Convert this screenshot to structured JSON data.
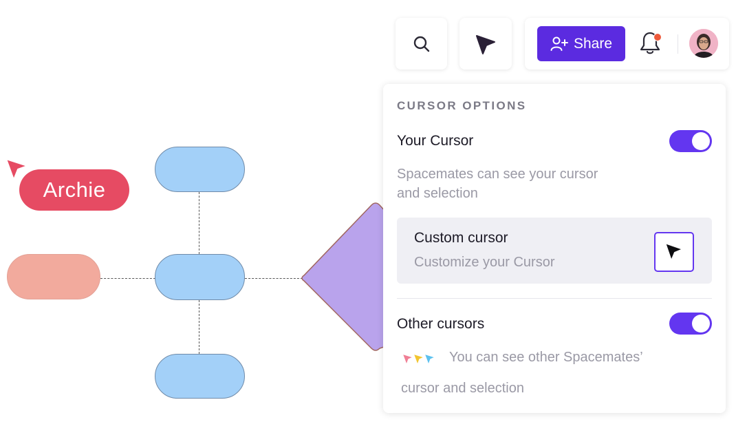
{
  "canvas": {
    "collaborator_name": "Archie",
    "colors": {
      "node_fill": "#a3d0f8",
      "node_border": "#6f8aa8",
      "salmon_node": "#f2aa9d",
      "diamond_fill": "#b9a3ec",
      "archie_color": "#e64b63"
    }
  },
  "toolbar": {
    "search_icon": "search-icon",
    "pointer_icon": "pointer-icon",
    "share_label": "Share",
    "share_icon": "add-user-icon",
    "bell_icon": "bell-icon",
    "accent": "#5b2be0"
  },
  "panel": {
    "title": "CURSOR OPTIONS",
    "your_cursor": {
      "label": "Your Cursor",
      "enabled": true,
      "description_line1": "Spacemates can see your cursor",
      "description_line2": "and selection"
    },
    "custom_cursor": {
      "label": "Custom cursor",
      "description": "Customize your Cursor"
    },
    "other_cursors": {
      "label": "Other cursors",
      "enabled": true,
      "description_line1": "You can see other Spacemates’",
      "description_line2": "cursor and selection"
    },
    "toggle_color": "#6336f0"
  }
}
